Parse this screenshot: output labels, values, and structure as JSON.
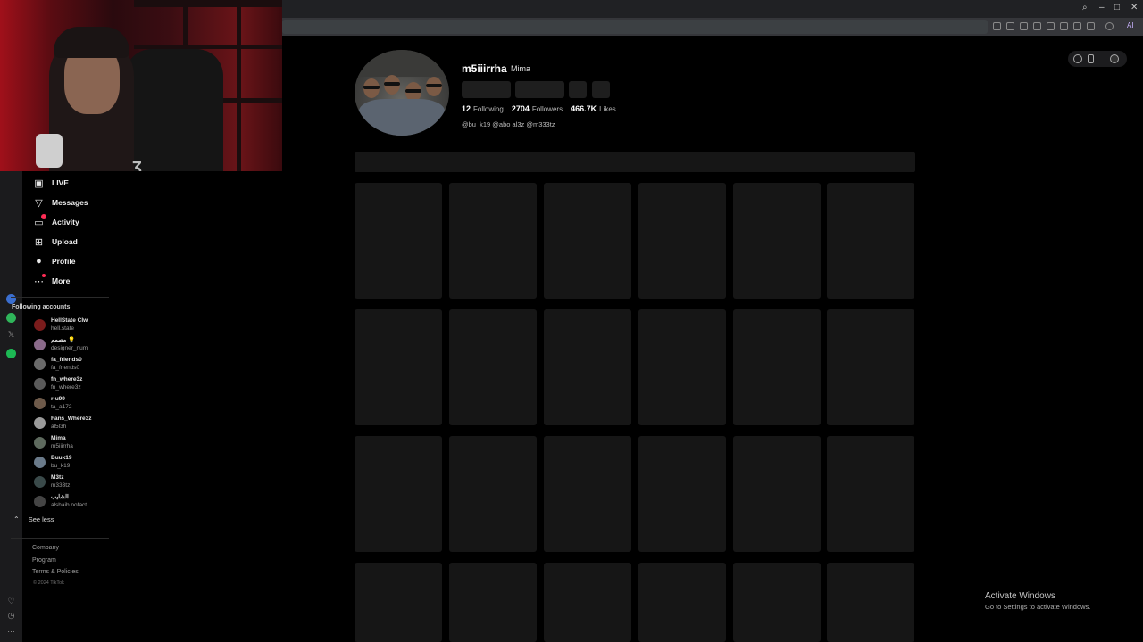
{
  "window": {
    "minimize": "–",
    "maximize": "□",
    "close": "✕",
    "search": "⌕"
  },
  "extensions": [
    {
      "icon": "capture-icon"
    },
    {
      "icon": "home-icon"
    },
    {
      "icon": "location-icon"
    },
    {
      "icon": "play-icon"
    },
    {
      "icon": "heart-icon"
    },
    {
      "icon": "download-icon"
    },
    {
      "icon": "list-icon"
    },
    {
      "icon": "user-icon"
    },
    {
      "icon": "extension-icon"
    }
  ],
  "ai_badge": "AI",
  "sidebar": {
    "nav": [
      {
        "label": "LIVE",
        "icon": "live-icon"
      },
      {
        "label": "Messages",
        "icon": "messages-icon"
      },
      {
        "label": "Activity",
        "icon": "activity-icon"
      },
      {
        "label": "Upload",
        "icon": "upload-icon"
      },
      {
        "label": "Profile",
        "icon": "profile-icon"
      },
      {
        "label": "More",
        "icon": "more-icon"
      }
    ],
    "following_title": "Following accounts",
    "following": [
      {
        "name": "HellState Clw",
        "handle": "hell.state",
        "color": "#7a1c1c"
      },
      {
        "name": "مصمم 💡",
        "handle": "designer_num",
        "color": "#8a6a8a"
      },
      {
        "name": "fa_friends0",
        "handle": "fa_friends0",
        "color": "#6a6a6a"
      },
      {
        "name": "fn_where3z",
        "handle": "fn_where3z",
        "color": "#5a5a5a"
      },
      {
        "name": "r-u99",
        "handle": "ta_a172",
        "color": "#6e5a4a"
      },
      {
        "name": "Fans_Where3z",
        "handle": "al5l3h",
        "color": "#9a9a9a"
      },
      {
        "name": "Mima",
        "handle": "m5iiirrha",
        "color": "#5e6a5e"
      },
      {
        "name": "Buuk19",
        "handle": "bu_k19",
        "color": "#6a7a8a"
      },
      {
        "name": "M3tz",
        "handle": "m333tz",
        "color": "#3a4a4a"
      },
      {
        "name": "الشايب",
        "handle": "alshaib.nofact",
        "color": "#444444"
      }
    ],
    "see_less": "See less",
    "footer": [
      "Company",
      "Program",
      "Terms & Policies"
    ],
    "copyright": "© 2024 TikTok"
  },
  "profile": {
    "username": "m5iiirrha",
    "nickname": "Mima",
    "stats": [
      {
        "value": "12",
        "label": "Following"
      },
      {
        "value": "2704",
        "label": "Followers"
      },
      {
        "value": "466.7K",
        "label": "Likes"
      }
    ],
    "bio": "@bu_k19 @abo al3z @m333tz"
  },
  "activation": {
    "title": "Activate Windows",
    "subtitle": "Go to Settings to activate Windows."
  }
}
